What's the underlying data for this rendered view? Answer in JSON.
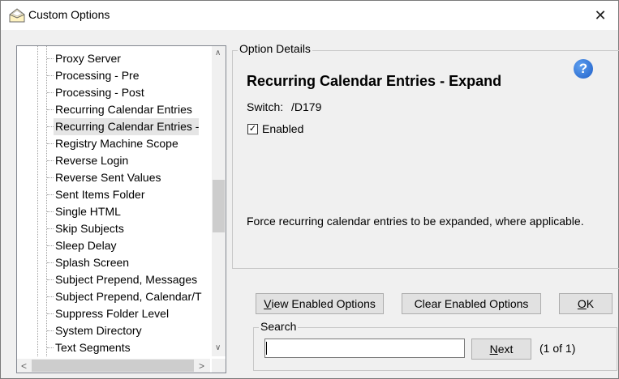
{
  "window": {
    "title": "Custom Options",
    "close_glyph": "✕",
    "icon": "envelope-icon"
  },
  "tree": {
    "items": [
      "Proxy Server",
      "Processing - Pre",
      "Processing - Post",
      "Recurring Calendar Entries",
      "Recurring Calendar Entries -",
      "Registry Machine Scope",
      "Reverse Login",
      "Reverse Sent Values",
      "Sent Items Folder",
      "Single HTML",
      "Skip Subjects",
      "Sleep Delay",
      "Splash Screen",
      "Subject Prepend, Messages",
      "Subject Prepend, Calendar/T",
      "Suppress Folder Level",
      "System Directory",
      "Text Segments"
    ],
    "selected_index": 4
  },
  "details": {
    "group_label": "Option Details",
    "title": "Recurring Calendar Entries - Expand",
    "switch_label": "Switch:",
    "switch_value": "/D179",
    "enabled_label": "Enabled",
    "enabled_checked": true,
    "check_glyph": "✓",
    "help_glyph": "?",
    "description": "Force recurring calendar entries to be expanded, where applicable."
  },
  "buttons": {
    "view_enabled": {
      "mnemonic": "V",
      "rest": "iew Enabled Options"
    },
    "clear_enabled": "Clear Enabled Options",
    "ok": {
      "mnemonic": "O",
      "rest": "K"
    }
  },
  "search": {
    "group_label": "Search",
    "value": "",
    "next": {
      "mnemonic": "N",
      "rest": "ext"
    },
    "count_text": "(1 of 1)"
  },
  "scroll_glyphs": {
    "up": "∧",
    "down": "∨",
    "left": "<",
    "right": ">"
  }
}
